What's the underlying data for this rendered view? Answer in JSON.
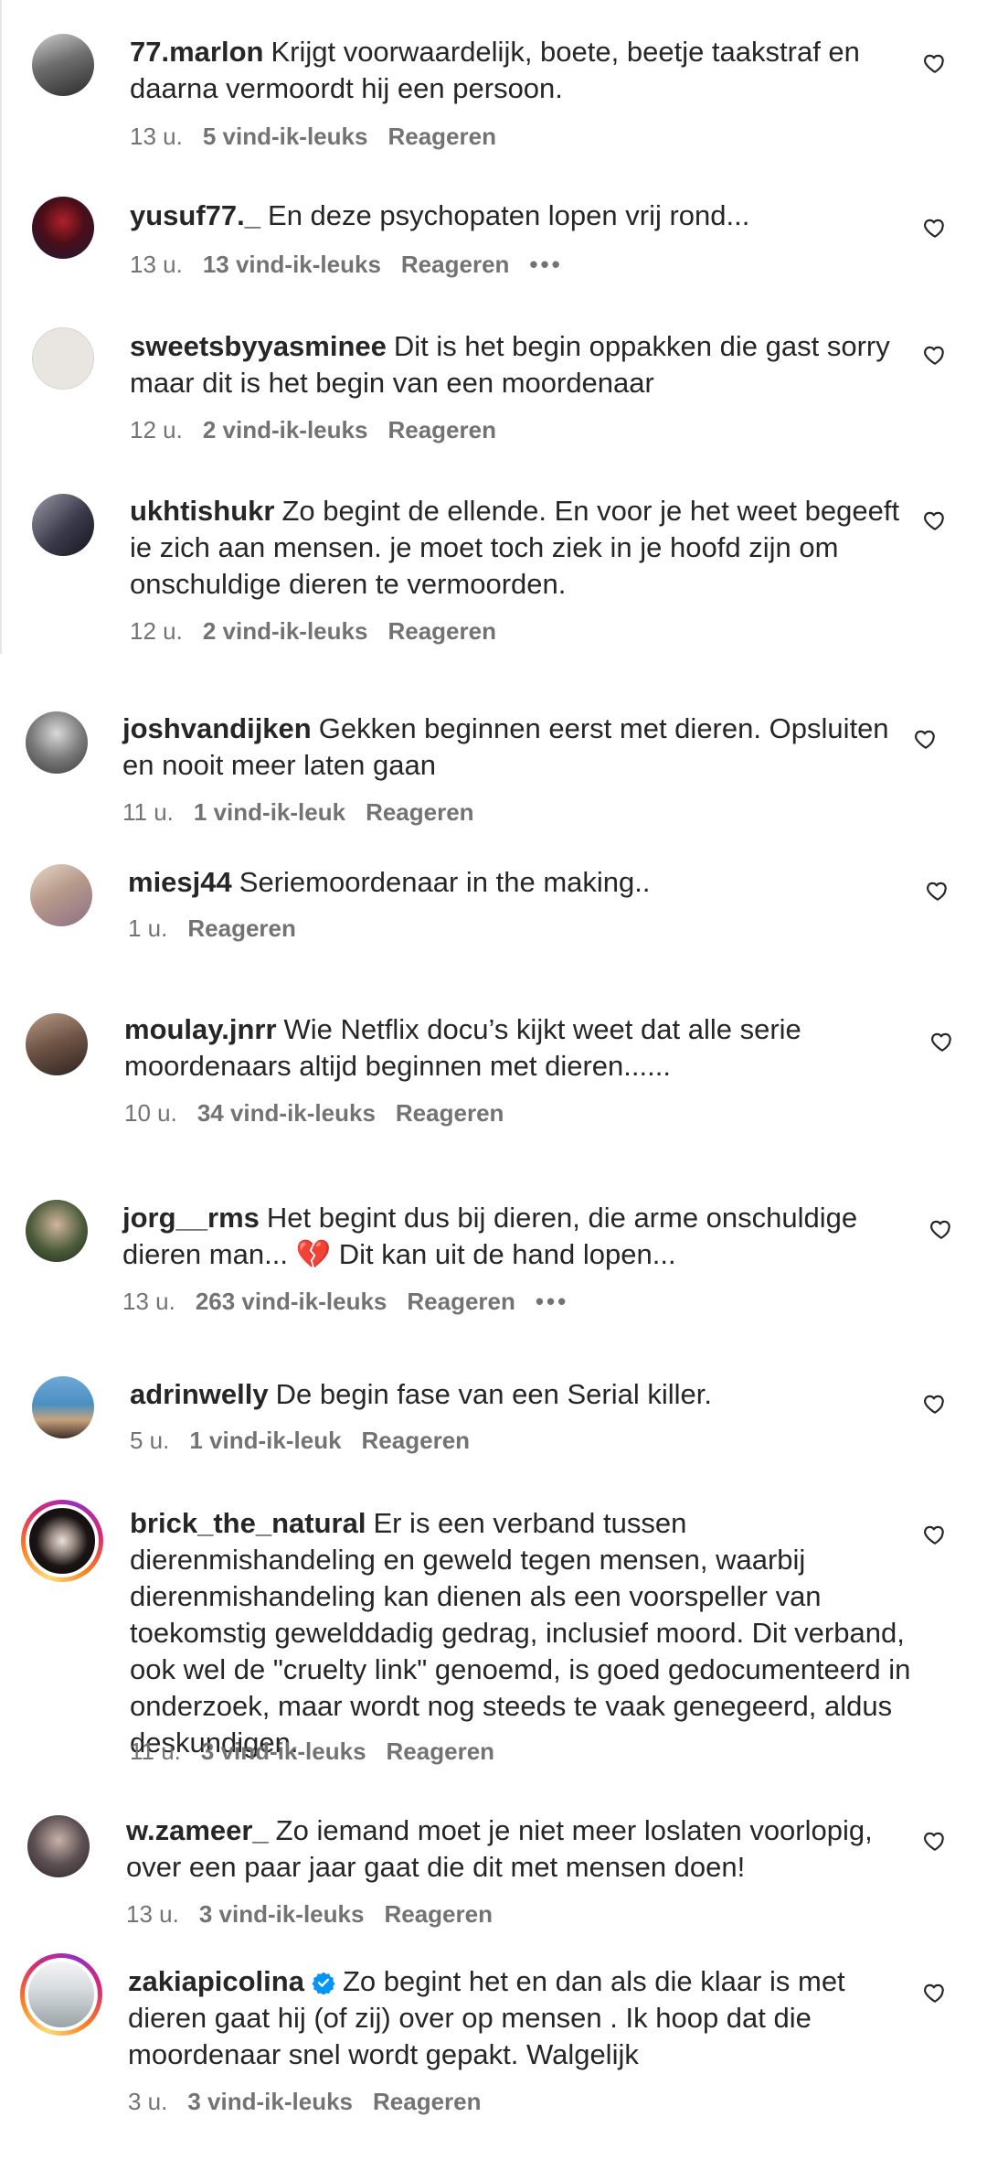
{
  "comments": [
    {
      "username": "77.marlon",
      "text": "Krijgt voorwaardelijk, boete, beetje taakstraf en daarna vermoordt hij een persoon.",
      "time": "13 u.",
      "likes": "5 vind-ik-leuks",
      "reply": "Reageren",
      "more": ""
    },
    {
      "username": "yusuf77._",
      "text": "En deze psychopaten lopen vrij rond...",
      "time": "13 u.",
      "likes": "13 vind-ik-leuks",
      "reply": "Reageren",
      "more": "•••"
    },
    {
      "username": "sweetsbyyasminee",
      "text": "Dit is het begin oppakken die gast sorry maar dit is het begin van een moordenaar",
      "time": "12 u.",
      "likes": "2 vind-ik-leuks",
      "reply": "Reageren",
      "more": ""
    },
    {
      "username": "ukhtishukr",
      "text": "Zo begint de ellende. En voor je het weet begeeft ie zich aan mensen. je moet toch ziek in je hoofd zijn om onschuldige dieren te vermoorden.",
      "time": "12 u.",
      "likes": "2 vind-ik-leuks",
      "reply": "Reageren",
      "more": ""
    },
    {
      "username": "joshvandijken",
      "text": "Gekken beginnen eerst met dieren. Opsluiten en nooit meer laten gaan",
      "time": "11 u.",
      "likes": "1 vind-ik-leuk",
      "reply": "Reageren",
      "more": ""
    },
    {
      "username": "miesj44",
      "text": "Seriemoordenaar in the making..",
      "time": "1 u.",
      "likes": "",
      "reply": "Reageren",
      "more": ""
    },
    {
      "username": "moulay.jnrr",
      "text": "Wie Netflix docu’s kijkt weet dat alle serie moordenaars altijd beginnen met dieren......",
      "time": "10 u.",
      "likes": "34 vind-ik-leuks",
      "reply": "Reageren",
      "more": ""
    },
    {
      "username": "jorg__rms",
      "text": "Het begint dus bij dieren, die arme onschuldige dieren man... 💔 Dit kan uit de hand lopen...",
      "time": "13 u.",
      "likes": "263 vind-ik-leuks",
      "reply": "Reageren",
      "more": "•••"
    },
    {
      "username": "adrinwelly",
      "text": "De begin fase van een Serial killer.",
      "time": "5 u.",
      "likes": "1 vind-ik-leuk",
      "reply": "Reageren",
      "more": ""
    },
    {
      "username": "brick_the_natural",
      "text": "Er is een verband tussen dierenmishandeling en geweld tegen mensen, waarbij dierenmishandeling kan dienen als een voorspeller van toekomstig gewelddadig gedrag, inclusief moord. Dit verband, ook wel de \"cruelty link\" genoemd, is goed gedocumenteerd in onderzoek, maar wordt nog steeds te vaak genegeerd, aldus deskundigen.",
      "time": "11 u.",
      "likes": "3 vind-ik-leuks",
      "reply": "Reageren",
      "more": ""
    },
    {
      "username": "w.zameer_",
      "text": "Zo iemand moet je niet meer loslaten voorlopig, over een paar jaar gaat die dit met mensen doen!",
      "time": "13 u.",
      "likes": "3 vind-ik-leuks",
      "reply": "Reageren",
      "more": ""
    },
    {
      "username": "zakiapicolina",
      "text": "Zo begint het en dan als die klaar is met dieren gaat hij (of zij) over op mensen . Ik hoop dat die moordenaar snel wordt gepakt. Walgelijk",
      "time": "3 u.",
      "likes": "3 vind-ik-leuks",
      "reply": "Reageren",
      "more": ""
    }
  ],
  "colors": {
    "text": "#262626",
    "meta": "#737373",
    "verified": "#0095f6",
    "story_ring": [
      "#feda75",
      "#fa7e1e",
      "#d62976",
      "#962fbf"
    ]
  }
}
